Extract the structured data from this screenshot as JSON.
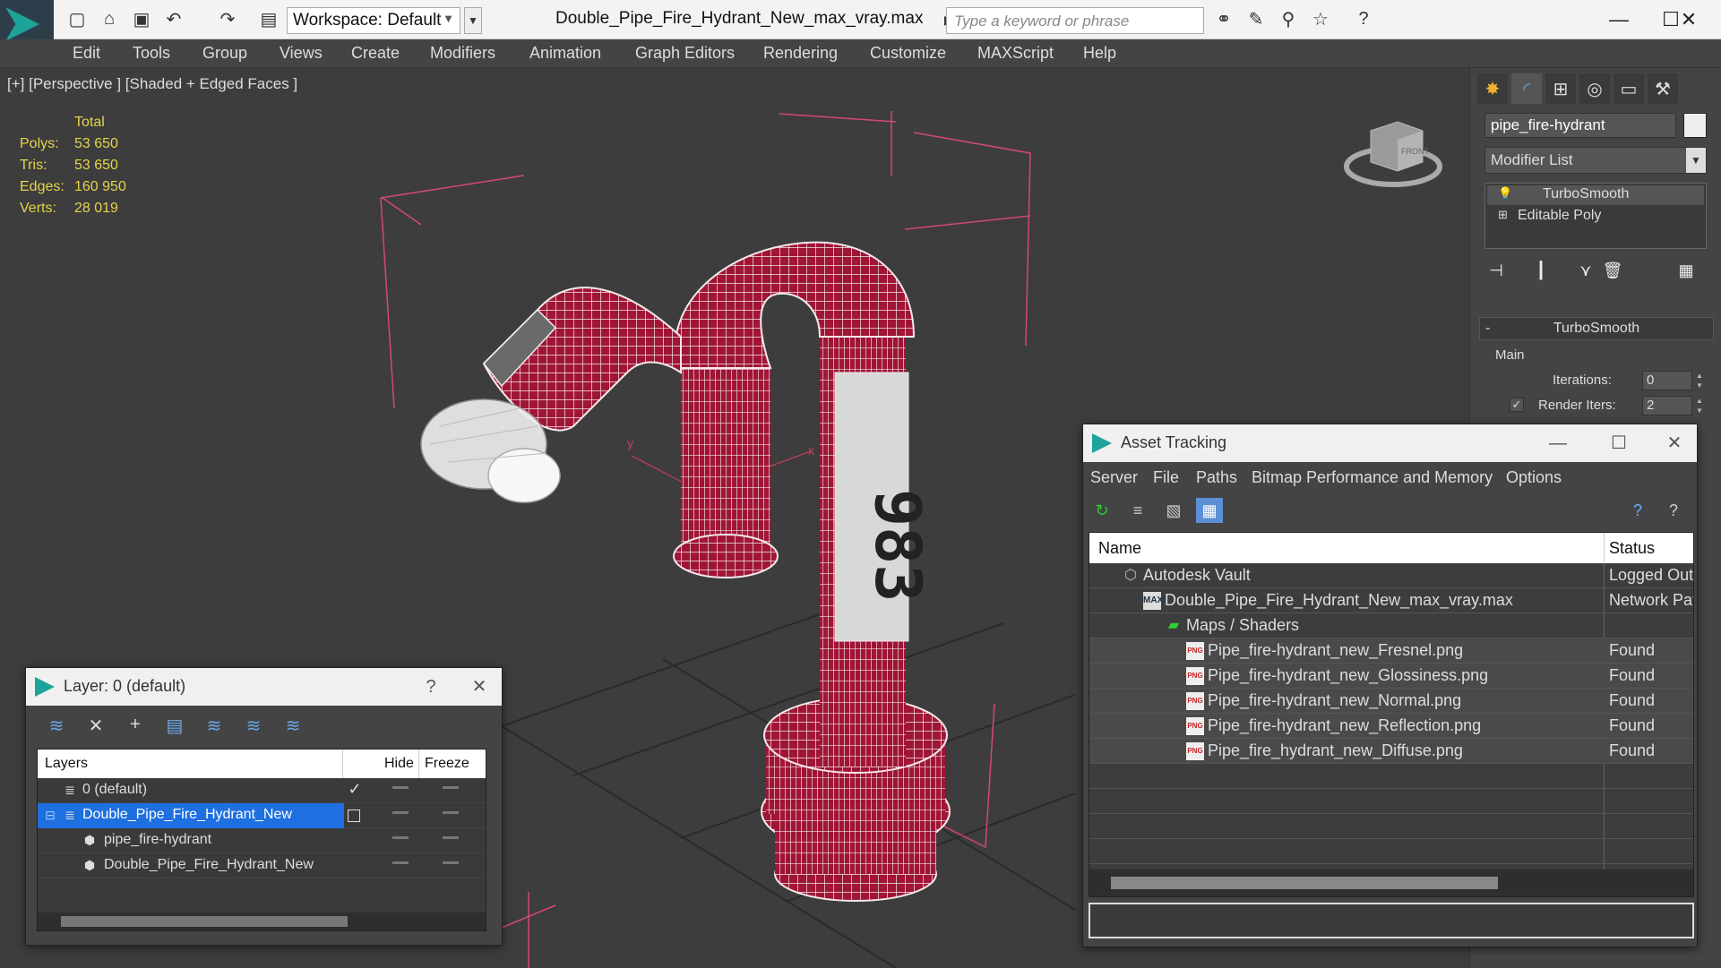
{
  "app": {
    "workspace": "Workspace: Default",
    "doc_title": "Double_Pipe_Fire_Hydrant_New_max_vray.max",
    "search_placeholder": "Type a keyword or phrase"
  },
  "menu": [
    "Edit",
    "Tools",
    "Group",
    "Views",
    "Create",
    "Modifiers",
    "Animation",
    "Graph Editors",
    "Rendering",
    "Customize",
    "MAXScript",
    "Help"
  ],
  "viewport": {
    "label": "[+] [Perspective ] [Shaded + Edged Faces ]",
    "stats_header": "Total",
    "stats": [
      {
        "label": "Polys:",
        "value": "53 650"
      },
      {
        "label": "Tris:",
        "value": "53 650"
      },
      {
        "label": "Edges:",
        "value": "160 950"
      },
      {
        "label": "Verts:",
        "value": "28 019"
      }
    ],
    "hydrant_number": "983",
    "viewcube_label": "FRONT"
  },
  "command_panel": {
    "object_name": "pipe_fire-hydrant",
    "modifier_list": "Modifier List",
    "stack": [
      "TurboSmooth",
      "Editable Poly"
    ],
    "rollout_title": "TurboSmooth",
    "group_label": "Main",
    "iterations_label": "Iterations:",
    "iterations_value": "0",
    "render_iters_label": "Render Iters:",
    "render_iters_value": "2"
  },
  "layer_dialog": {
    "title": "Layer: 0 (default)",
    "help": "?",
    "columns": {
      "layers": "Layers",
      "hide": "Hide",
      "freeze": "Freeze"
    },
    "rows": [
      {
        "name": "0 (default)"
      },
      {
        "name": "Double_Pipe_Fire_Hydrant_New"
      },
      {
        "name": "pipe_fire-hydrant"
      },
      {
        "name": "Double_Pipe_Fire_Hydrant_New"
      }
    ]
  },
  "asset_dialog": {
    "title": "Asset Tracking",
    "menu": [
      "Server",
      "File",
      "Paths",
      "Bitmap Performance and Memory",
      "Options"
    ],
    "columns": {
      "name": "Name",
      "status": "Status"
    },
    "rows": [
      {
        "name": "Autodesk Vault",
        "status": "Logged Out"
      },
      {
        "name": "Double_Pipe_Fire_Hydrant_New_max_vray.max",
        "status": "Network Pat"
      },
      {
        "name": "Maps / Shaders",
        "status": ""
      },
      {
        "name": "Pipe_fire-hydrant_new_Fresnel.png",
        "status": "Found"
      },
      {
        "name": "Pipe_fire-hydrant_new_Glossiness.png",
        "status": "Found"
      },
      {
        "name": "Pipe_fire-hydrant_new_Normal.png",
        "status": "Found"
      },
      {
        "name": "Pipe_fire-hydrant_new_Reflection.png",
        "status": "Found"
      },
      {
        "name": "Pipe_fire_hydrant_new_Diffuse.png",
        "status": "Found"
      }
    ],
    "png_badge": "PNG"
  }
}
